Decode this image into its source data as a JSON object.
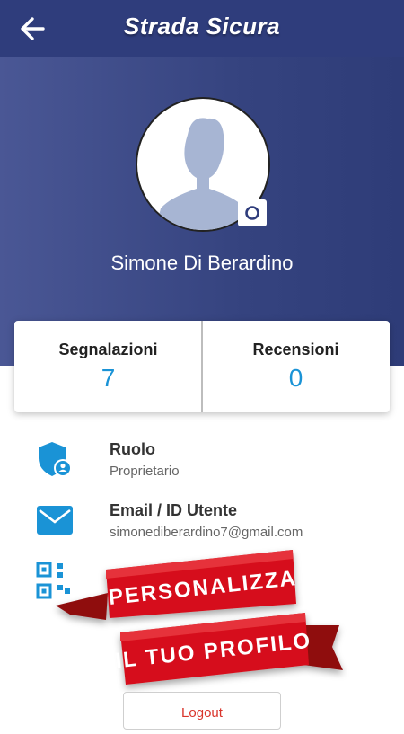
{
  "app_bar": {
    "title": "Strada Sicura",
    "back_icon": "arrow-left-icon"
  },
  "profile": {
    "name": "Simone Di Berardino",
    "camera_icon": "camera-icon"
  },
  "stats": [
    {
      "label": "Segnalazioni",
      "value": "7"
    },
    {
      "label": "Recensioni",
      "value": "0"
    }
  ],
  "info": {
    "role": {
      "title": "Ruolo",
      "value": "Proprietario",
      "icon": "shield-user-icon"
    },
    "email": {
      "title": "Email / ID Utente",
      "value": "simonediberardino7@gmail.com",
      "icon": "mail-icon"
    },
    "qr": {
      "icon": "qr-code-icon"
    }
  },
  "promo": {
    "line1": "PERSONALIZZA",
    "line2": "IL TUO PROFILO"
  },
  "actions": {
    "logout_label": "Logout"
  },
  "colors": {
    "primary": "#2f3d7c",
    "accent": "#1a93d6",
    "banner_red": "#d6111a",
    "logout_red": "#d9342b"
  }
}
